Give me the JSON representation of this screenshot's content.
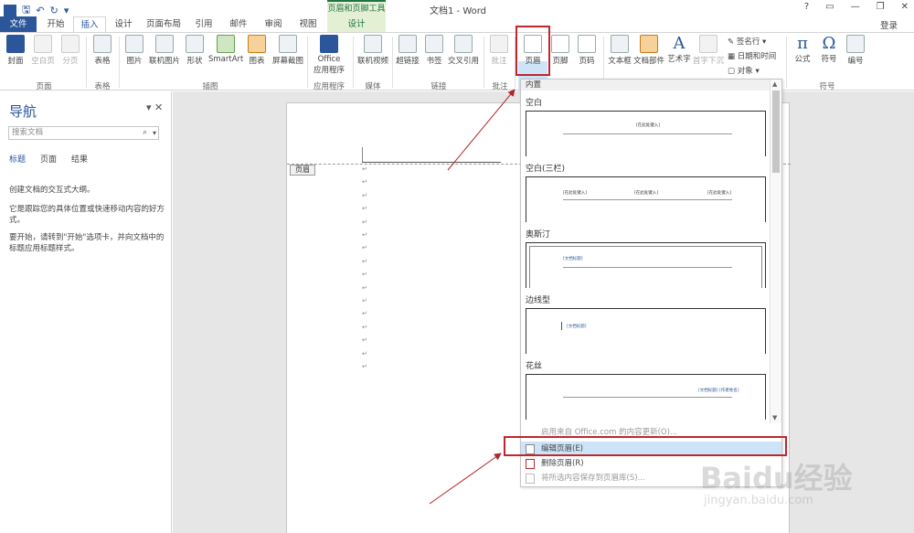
{
  "titlebar": {
    "doc_title": "文档1 - Word",
    "tools_banner": "页眉和页脚工具",
    "login": "登录",
    "help": "?",
    "minimize": "—",
    "restore": "❐",
    "close": "✕"
  },
  "tabs": [
    "文件",
    "开始",
    "插入",
    "设计",
    "页面布局",
    "引用",
    "邮件",
    "审阅",
    "视图",
    "设计"
  ],
  "ribbon": {
    "buttons": [
      "封面",
      "空白页",
      "分页",
      "表格",
      "图片",
      "联机图片",
      "形状",
      "SmartArt",
      "图表",
      "屏幕截图",
      "Office\n应用程序",
      "联机视频",
      "超链接",
      "书签",
      "交叉引用",
      "批注",
      "页眉",
      "页脚",
      "页码",
      "文本框",
      "文档部件",
      "艺术字",
      "首字下沉",
      "公式",
      "符号",
      "编号"
    ],
    "small_buttons": [
      "签名行",
      "日期和时间",
      "对象"
    ],
    "groups": [
      "页面",
      "表格",
      "插图",
      "应用程序",
      "媒体",
      "链接",
      "批注",
      "符号"
    ]
  },
  "nav": {
    "title": "导航",
    "search_placeholder": "搜索文档",
    "tabs": [
      "标题",
      "页面",
      "结果"
    ],
    "text1": "创建文档的交互式大纲。",
    "text2": "它是跟踪您的具体位置或快速移动内容的好方式。",
    "text3": "要开始，请转到\"开始\"选项卡，并向文档中的标题应用标题样式。"
  },
  "doc": {
    "header_tag": "页眉",
    "para_mark": "↵"
  },
  "gallery": {
    "section_header": "内置",
    "items": [
      {
        "name": "空白",
        "placeholder": "[在此处键入]"
      },
      {
        "name": "空白(三栏)",
        "placeholder": "[在此处键入]"
      },
      {
        "name": "奥斯汀",
        "placeholder": "[文档标题]"
      },
      {
        "name": "边线型",
        "placeholder": "[文档标题]"
      },
      {
        "name": "花丝",
        "placeholder": "[文档标题] [作者姓名]"
      }
    ],
    "menu": [
      {
        "label": "启用来自 Office.com 的内容更新(O)..."
      },
      {
        "label": "编辑页眉(E)"
      },
      {
        "label": "删除页眉(R)"
      },
      {
        "label": "将所选内容保存到页眉库(S)..."
      }
    ]
  },
  "watermark": {
    "logo": "Baidu经验",
    "url": "jingyan.baidu.com"
  },
  "colors": {
    "accent": "#2b579a",
    "tools": "#217346",
    "highlight": "#c0262d",
    "hover": "#cde3f7"
  }
}
